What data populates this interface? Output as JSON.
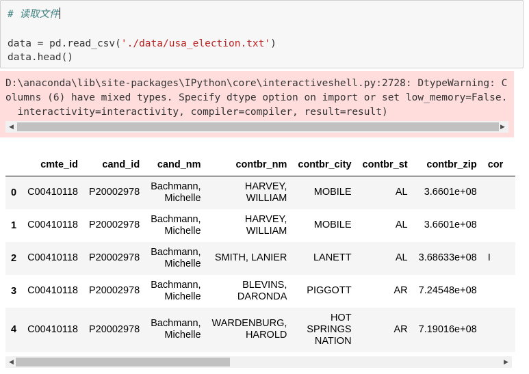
{
  "code": {
    "comment": "# 读取文件",
    "line2_prefix": "data = pd.read_csv(",
    "line2_string": "'./data/usa_election.txt'",
    "line2_suffix": ")",
    "line3": "data.head()"
  },
  "stderr": {
    "lines": [
      "D:\\anaconda\\lib\\site-packages\\IPython\\core\\interactiveshell.py:2728: DtypeWarning: C",
      "olumns (6) have mixed types. Specify dtype option on import or set low_memory=False.",
      "  interactivity=interactivity, compiler=compiler, result=result)"
    ]
  },
  "table": {
    "columns": [
      "",
      "cmte_id",
      "cand_id",
      "cand_nm",
      "contbr_nm",
      "contbr_city",
      "contbr_st",
      "contbr_zip",
      "cor"
    ],
    "rows": [
      {
        "idx": "0",
        "cmte_id": "C00410118",
        "cand_id": "P20002978",
        "cand_nm": [
          "Bachmann,",
          "Michelle"
        ],
        "contbr_nm": [
          "HARVEY,",
          "WILLIAM"
        ],
        "contbr_city": [
          "MOBILE"
        ],
        "contbr_st": "AL",
        "contbr_zip": "3.6601e+08",
        "cut": ""
      },
      {
        "idx": "1",
        "cmte_id": "C00410118",
        "cand_id": "P20002978",
        "cand_nm": [
          "Bachmann,",
          "Michelle"
        ],
        "contbr_nm": [
          "HARVEY,",
          "WILLIAM"
        ],
        "contbr_city": [
          "MOBILE"
        ],
        "contbr_st": "AL",
        "contbr_zip": "3.6601e+08",
        "cut": ""
      },
      {
        "idx": "2",
        "cmte_id": "C00410118",
        "cand_id": "P20002978",
        "cand_nm": [
          "Bachmann,",
          "Michelle"
        ],
        "contbr_nm": [
          "SMITH, LANIER"
        ],
        "contbr_city": [
          "LANETT"
        ],
        "contbr_st": "AL",
        "contbr_zip": "3.68633e+08",
        "cut": "I"
      },
      {
        "idx": "3",
        "cmte_id": "C00410118",
        "cand_id": "P20002978",
        "cand_nm": [
          "Bachmann,",
          "Michelle"
        ],
        "contbr_nm": [
          "BLEVINS,",
          "DARONDA"
        ],
        "contbr_city": [
          "PIGGOTT"
        ],
        "contbr_st": "AR",
        "contbr_zip": "7.24548e+08",
        "cut": ""
      },
      {
        "idx": "4",
        "cmte_id": "C00410118",
        "cand_id": "P20002978",
        "cand_nm": [
          "Bachmann,",
          "Michelle"
        ],
        "contbr_nm": [
          "WARDENBURG,",
          "HAROLD"
        ],
        "contbr_city": [
          "HOT",
          "SPRINGS",
          "NATION"
        ],
        "contbr_st": "AR",
        "contbr_zip": "7.19016e+08",
        "cut": ""
      }
    ]
  },
  "icons": {
    "left": "triangle-left",
    "right": "triangle-right"
  }
}
